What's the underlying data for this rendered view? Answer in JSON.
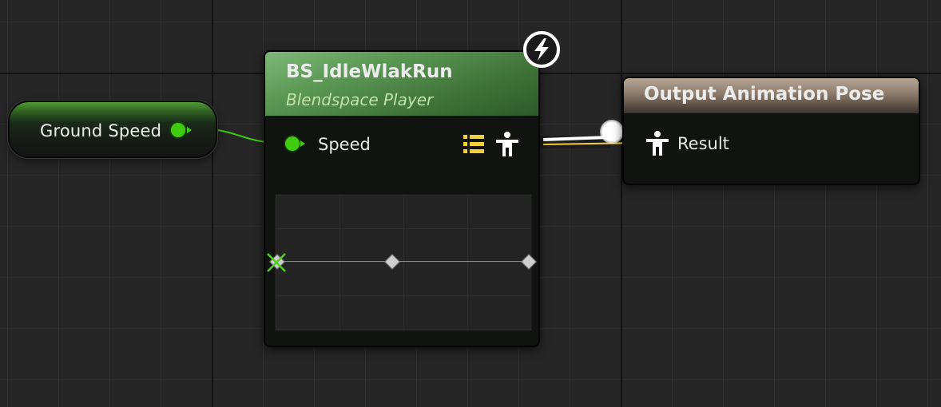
{
  "variable_node": {
    "label": "Ground Speed",
    "pin_color": "#3ecb10"
  },
  "blendspace_node": {
    "title": "BS_IdleWlakRun",
    "subtitle": "Blendspace Player",
    "header_color": "#5d9a56",
    "input_pin_label": "Speed",
    "icons": [
      "list-icon",
      "pose-icon",
      "flash-icon"
    ]
  },
  "output_node": {
    "title": "Output Animation Pose",
    "header_color": "#8b7a6a",
    "input_pin_label": "Result",
    "icons": [
      "pose-icon"
    ]
  },
  "colors": {
    "float_wire": "#3ecb10",
    "pose_wire": "#ffffff",
    "exec_highlight": "#f2d13a",
    "canvas_bg": "#262626"
  }
}
